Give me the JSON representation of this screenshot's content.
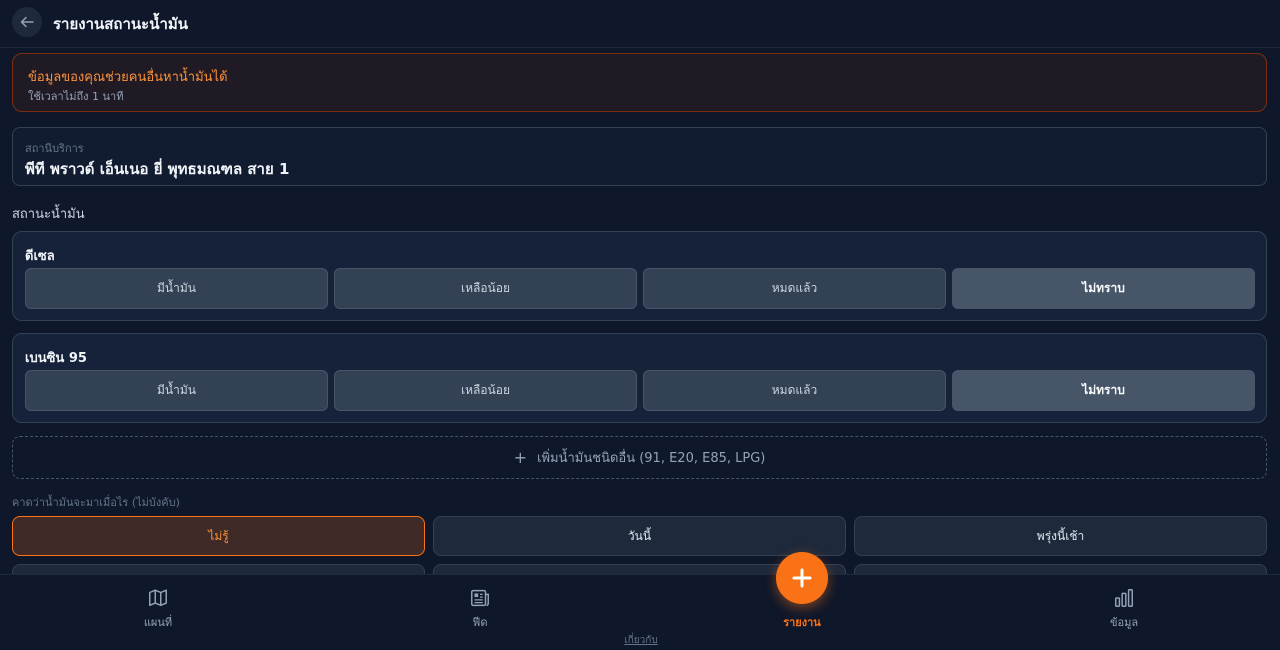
{
  "header": {
    "title": "รายงานสถานะน้ำมัน",
    "back_icon": "arrow-left-icon"
  },
  "banner": {
    "title": "ข้อมูลของคุณช่วยคนอื่นหาน้ำมันได้",
    "subtitle": "ใช้เวลาไม่ถึง 1 นาที"
  },
  "station": {
    "label": "สถานีบริการ",
    "value": "พีที พราวด์ เอ็นเนอ ยี่ พุทธมณฑล สาย 1"
  },
  "status_section_title": "สถานะน้ำมัน",
  "fuels": [
    {
      "name": "ดีเซล",
      "options": [
        "มีน้ำมัน",
        "เหลือน้อย",
        "หมดแล้ว",
        "ไม่ทราบ"
      ],
      "selected": "ไม่ทราบ"
    },
    {
      "name": "เบนซิน 95",
      "options": [
        "มีน้ำมัน",
        "เหลือน้อย",
        "หมดแล้ว",
        "ไม่ทราบ"
      ],
      "selected": "ไม่ทราบ"
    }
  ],
  "add_fuel": {
    "label": "เพิ่มน้ำมันชนิดอื่น (91, E20, E85, LPG)",
    "icon": "plus-icon"
  },
  "eta": {
    "label": "คาดว่าน้ำมันจะมาเมื่อไร (ไม่บังคับ)",
    "options": [
      "ไม่รู้",
      "วันนี้",
      "พรุ่งนี้เช้า"
    ],
    "selected": "ไม่รู้"
  },
  "nav": {
    "items": [
      {
        "label": "แผนที่",
        "icon": "map-icon"
      },
      {
        "label": "ฟีด",
        "icon": "newspaper-icon"
      },
      {
        "label": "รายงาน",
        "icon": "plus-icon"
      },
      {
        "label": "ข้อมูล",
        "icon": "bar-chart-icon"
      }
    ],
    "active": "รายงาน",
    "about_link": "เกี่ยวกับ"
  },
  "colors": {
    "accent": "#f97316",
    "background": "#0f172a",
    "card": "#16223a",
    "selected_option": "#475569"
  }
}
